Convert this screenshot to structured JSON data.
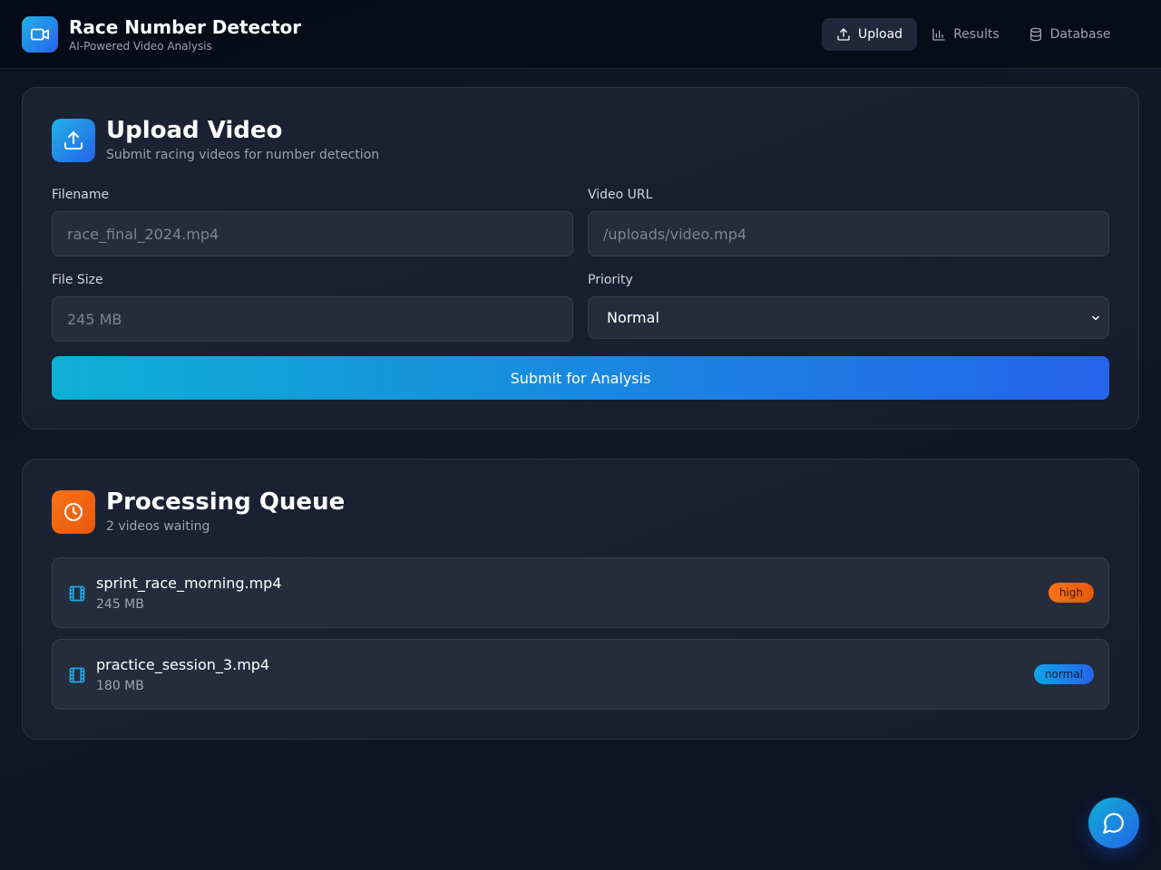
{
  "header": {
    "title": "Race Number Detector",
    "subtitle": "AI-Powered Video Analysis",
    "nav": {
      "upload": "Upload",
      "results": "Results",
      "database": "Database"
    },
    "active_tab": "Upload"
  },
  "upload": {
    "title": "Upload Video",
    "subtitle": "Submit racing videos for number detection",
    "filename": {
      "label": "Filename",
      "placeholder": "race_final_2024.mp4",
      "value": ""
    },
    "video_url": {
      "label": "Video URL",
      "placeholder": "/uploads/video.mp4",
      "value": ""
    },
    "file_size": {
      "label": "File Size",
      "placeholder": "245 MB",
      "value": ""
    },
    "priority": {
      "label": "Priority",
      "selected": "Normal"
    },
    "submit_label": "Submit for Analysis"
  },
  "queue": {
    "title": "Processing Queue",
    "subtitle": "2 videos waiting",
    "items": [
      {
        "name": "sprint_race_morning.mp4",
        "size": "245 MB",
        "priority": "high"
      },
      {
        "name": "practice_session_3.mp4",
        "size": "180 MB",
        "priority": "normal"
      }
    ]
  },
  "colors": {
    "accent": "#0eb0d4",
    "accent_end": "#2563eb",
    "queue_accent": "#f97316",
    "badge_high": "#f97316",
    "badge_normal": "#0ea5e9"
  },
  "icons": {
    "logo": "video-camera-icon",
    "nav_upload": "upload-icon",
    "nav_results": "bar-chart-icon",
    "nav_database": "database-icon",
    "upload_card": "upload-icon",
    "queue_card": "clock-icon",
    "queue_item": "film-icon",
    "chat": "chat-bubble-icon"
  }
}
